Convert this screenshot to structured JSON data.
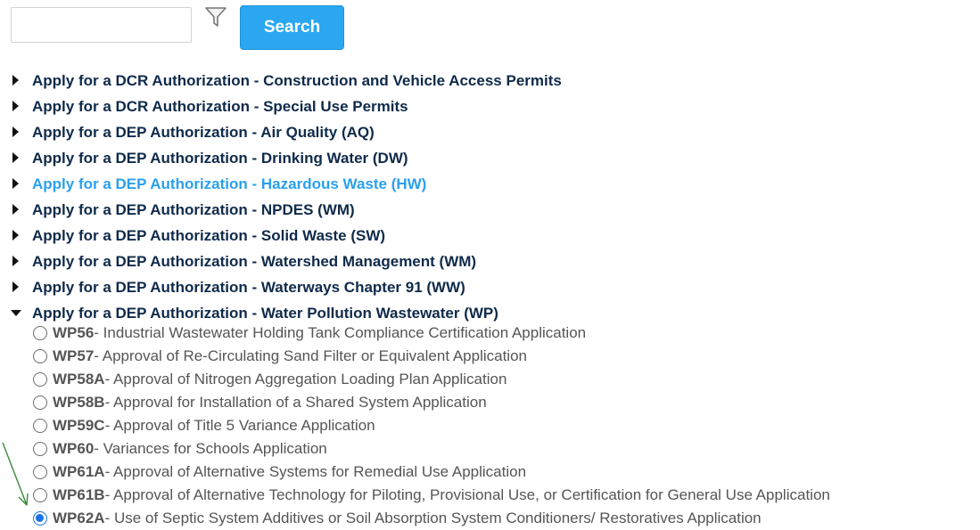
{
  "search": {
    "placeholder": "",
    "value": "",
    "button_label": "Search"
  },
  "icons": {
    "filter": "filter-funnel-icon"
  },
  "categories": [
    {
      "label": "Apply for a DCR Authorization - Construction and Vehicle Access Permits",
      "expanded": false
    },
    {
      "label": "Apply for a DCR Authorization - Special Use Permits",
      "expanded": false
    },
    {
      "label": "Apply for a DEP Authorization - Air Quality (AQ)",
      "expanded": false
    },
    {
      "label": "Apply for a DEP Authorization - Drinking Water (DW)",
      "expanded": false
    },
    {
      "label": "Apply for a DEP Authorization - Hazardous Waste (HW)",
      "expanded": false,
      "hovered": true
    },
    {
      "label": "Apply for a DEP Authorization - NPDES (WM)",
      "expanded": false
    },
    {
      "label": "Apply for a DEP Authorization - Solid Waste (SW)",
      "expanded": false
    },
    {
      "label": "Apply for a DEP Authorization - Watershed Management (WM)",
      "expanded": false
    },
    {
      "label": "Apply for a DEP Authorization - Waterways Chapter 91 (WW)",
      "expanded": false
    },
    {
      "label": "Apply for a DEP Authorization - Water Pollution Wastewater (WP)",
      "expanded": true
    }
  ],
  "options": [
    {
      "code": "WP56",
      "text": " - Industrial Wastewater Holding Tank Compliance Certification Application",
      "selected": false
    },
    {
      "code": "WP57",
      "text": " - Approval of Re-Circulating Sand Filter or Equivalent Application",
      "selected": false
    },
    {
      "code": "WP58A",
      "text": " - Approval of Nitrogen Aggregation Loading Plan Application",
      "selected": false
    },
    {
      "code": "WP58B",
      "text": " - Approval for Installation of a Shared System Application",
      "selected": false
    },
    {
      "code": "WP59C",
      "text": " - Approval of Title 5 Variance Application",
      "selected": false
    },
    {
      "code": "WP60",
      "text": " - Variances for Schools Application",
      "selected": false
    },
    {
      "code": "WP61A",
      "text": " - Approval of Alternative Systems for Remedial Use Application",
      "selected": false
    },
    {
      "code": "WP61B",
      "text": " - Approval of Alternative Technology for Piloting, Provisional Use, or Certification for General Use Application",
      "selected": false
    },
    {
      "code": "WP62A",
      "text": " - Use of Septic System Additives or Soil Absorption System Conditioners/ Restoratives Application",
      "selected": true
    }
  ],
  "colors": {
    "button_bg": "#2aa7f0",
    "category_text": "#0f2a4a",
    "category_hover": "#2aa0ee",
    "option_text": "#555555",
    "radio_selected": "#1a73e8",
    "annotation_arrow": "#3a8a3a"
  }
}
